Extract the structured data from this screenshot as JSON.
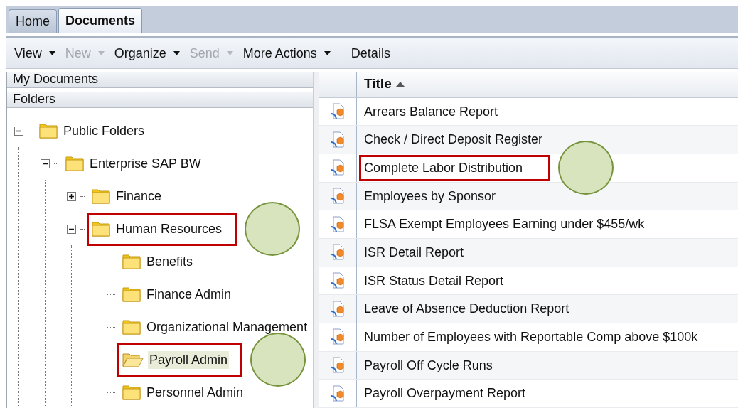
{
  "tabs": [
    {
      "label": "Home",
      "selected": false
    },
    {
      "label": "Documents",
      "selected": true
    }
  ],
  "toolbar": [
    {
      "label": "View",
      "kind": "menu",
      "disabled": false
    },
    {
      "label": "New",
      "kind": "menu",
      "disabled": true
    },
    {
      "label": "Organize",
      "kind": "menu",
      "disabled": false
    },
    {
      "label": "Send",
      "kind": "menu",
      "disabled": true
    },
    {
      "label": "More Actions",
      "kind": "menu",
      "disabled": false
    },
    {
      "label": "Details",
      "kind": "button",
      "disabled": false
    }
  ],
  "sidebar": {
    "sections": [
      "My Documents",
      "Folders"
    ],
    "tree": [
      {
        "label": "Public Folders",
        "expanded": true,
        "selected": false,
        "highlighted": false,
        "children": [
          {
            "label": "Enterprise SAP BW",
            "expanded": true,
            "selected": false,
            "highlighted": false,
            "children": [
              {
                "label": "Finance",
                "expanded": false,
                "selected": false,
                "highlighted": false
              },
              {
                "label": "Human Resources",
                "expanded": true,
                "selected": false,
                "highlighted": true,
                "callout": true,
                "children": [
                  {
                    "label": "Benefits",
                    "selected": false,
                    "highlighted": false
                  },
                  {
                    "label": "Finance Admin",
                    "selected": false,
                    "highlighted": false
                  },
                  {
                    "label": "Organizational Management",
                    "selected": false,
                    "highlighted": false
                  },
                  {
                    "label": "Payroll Admin",
                    "selected": true,
                    "highlighted": true,
                    "callout": true
                  },
                  {
                    "label": "Personnel Admin",
                    "selected": false,
                    "highlighted": false
                  }
                ]
              }
            ]
          }
        ]
      }
    ]
  },
  "table": {
    "columns": [
      "Title"
    ],
    "rows": [
      {
        "title": "Arrears Balance Report",
        "highlighted": false
      },
      {
        "title": "Check / Direct Deposit Register",
        "highlighted": false
      },
      {
        "title": "Complete Labor Distribution",
        "highlighted": true,
        "callout": true
      },
      {
        "title": "Employees by Sponsor",
        "highlighted": false
      },
      {
        "title": "FLSA Exempt Employees Earning under $455/wk",
        "highlighted": false
      },
      {
        "title": "ISR Detail Report",
        "highlighted": false
      },
      {
        "title": "ISR Status Detail Report",
        "highlighted": false
      },
      {
        "title": "Leave of Absence Deduction Report",
        "highlighted": false
      },
      {
        "title": "Number of Employees with Reportable Comp above $100k",
        "highlighted": false
      },
      {
        "title": "Payroll Off Cycle Runs",
        "highlighted": false
      },
      {
        "title": "Payroll Overpayment Report",
        "highlighted": false
      }
    ]
  }
}
